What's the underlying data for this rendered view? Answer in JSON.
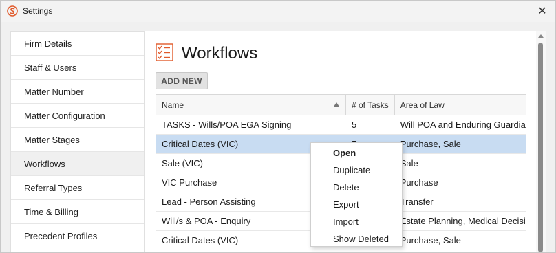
{
  "window": {
    "title": "Settings",
    "close_glyph": "✕",
    "app_icon": "logo-icon",
    "accent_color": "#e05a2b"
  },
  "sidebar": {
    "items": [
      {
        "label": "Firm Details"
      },
      {
        "label": "Staff & Users"
      },
      {
        "label": "Matter Number"
      },
      {
        "label": "Matter Configuration"
      },
      {
        "label": "Matter Stages"
      },
      {
        "label": "Workflows",
        "active": true
      },
      {
        "label": "Referral Types"
      },
      {
        "label": "Time & Billing"
      },
      {
        "label": "Precedent Profiles"
      }
    ]
  },
  "main": {
    "title": "Workflows",
    "title_icon": "checklist-icon",
    "add_button_label": "ADD NEW",
    "selected_row_color": "#c8dcf2"
  },
  "grid": {
    "columns": [
      "Name",
      "# of Tasks",
      "Area of Law"
    ],
    "sort_icon": "sort-ascending-icon",
    "rows": [
      {
        "name": "TASKS - Wills/POA EGA Signing",
        "tasks": "5",
        "area": "Will POA and Enduring Guardian"
      },
      {
        "name": "Critical Dates (VIC)",
        "tasks": "5",
        "area": "Purchase, Sale",
        "selected": true
      },
      {
        "name": "Sale (VIC)",
        "tasks": "",
        "area": "Sale"
      },
      {
        "name": "VIC Purchase",
        "tasks": "",
        "area": "Purchase"
      },
      {
        "name": "Lead - Person Assisting",
        "tasks": "",
        "area": "Transfer"
      },
      {
        "name": "Will/s & POA - Enquiry",
        "tasks": "",
        "area": "Estate Planning, Medical Decisio"
      },
      {
        "name": "Critical Dates (VIC)",
        "tasks": "",
        "area": "Purchase, Sale"
      }
    ]
  },
  "context_menu": {
    "items": [
      "Open",
      "Duplicate",
      "Delete",
      "Export",
      "Import",
      "Show Deleted"
    ]
  }
}
